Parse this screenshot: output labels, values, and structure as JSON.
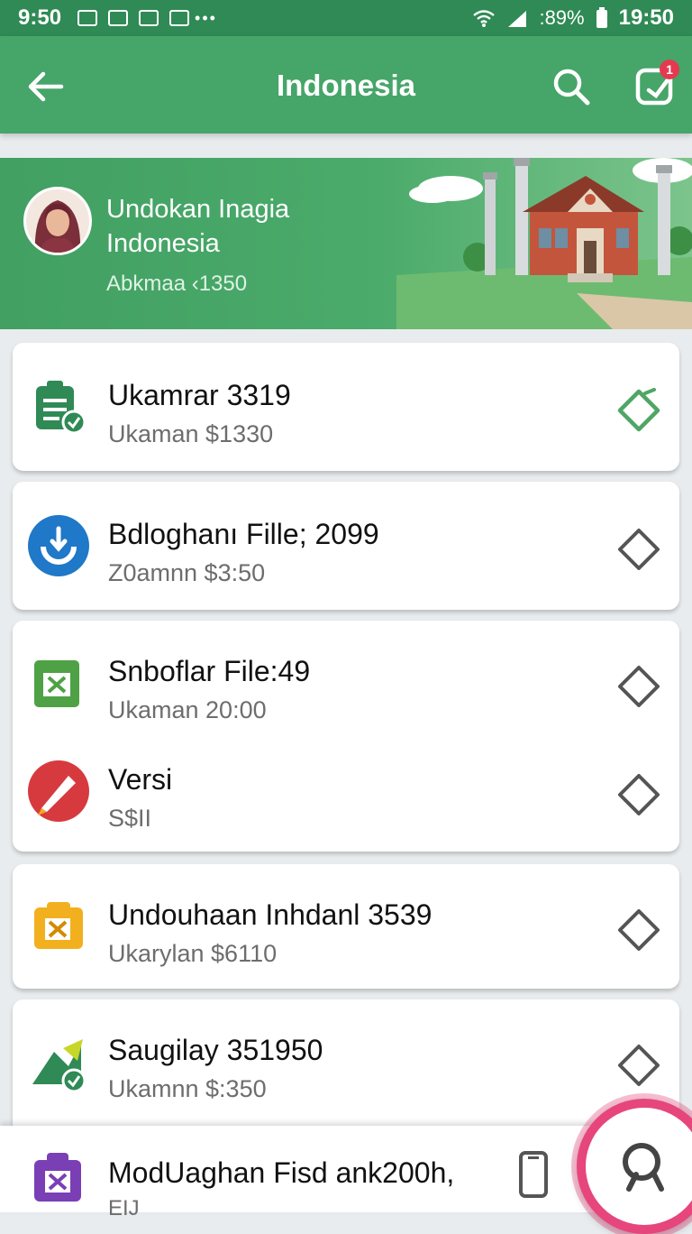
{
  "status_bar": {
    "time": "9:50",
    "battery": ":89%",
    "clock": "19:50"
  },
  "app_bar": {
    "title": "Indonesia",
    "badge_count": "1"
  },
  "banner": {
    "name_line1": "Undokan Inagia",
    "name_line2": "Indonesia",
    "meta": "Abkmaa ‹1350"
  },
  "items": [
    {
      "title": "Ukamrar 3319",
      "subtitle": "Ukaman $1330",
      "icon": "clipboard-icon"
    },
    {
      "title": "Bdloghanı Fille; 2099",
      "subtitle": "Z0amnn $3:50",
      "icon": "sync-icon"
    },
    {
      "title": "Snboflar File:49",
      "subtitle": "Ukaman 20:00",
      "icon": "spreadsheet-icon"
    },
    {
      "title": "Versi",
      "subtitle": "S$II",
      "icon": "pen-icon"
    },
    {
      "title": "Undouhaan Inhdanl 3539",
      "subtitle": "Ukarylan $6110",
      "icon": "orange-file-icon"
    },
    {
      "title": "Saugilay 351950",
      "subtitle": "Ukamnn $:350",
      "icon": "arrow-file-icon"
    }
  ],
  "bottom_item": {
    "title": "ModUaghan Fisd ank200h,",
    "subtitle": "EIJ",
    "icon": "purple-bag-icon"
  },
  "colors": {
    "primary": "#46a568",
    "status": "#2f8a55",
    "accent": "#e6467c"
  }
}
